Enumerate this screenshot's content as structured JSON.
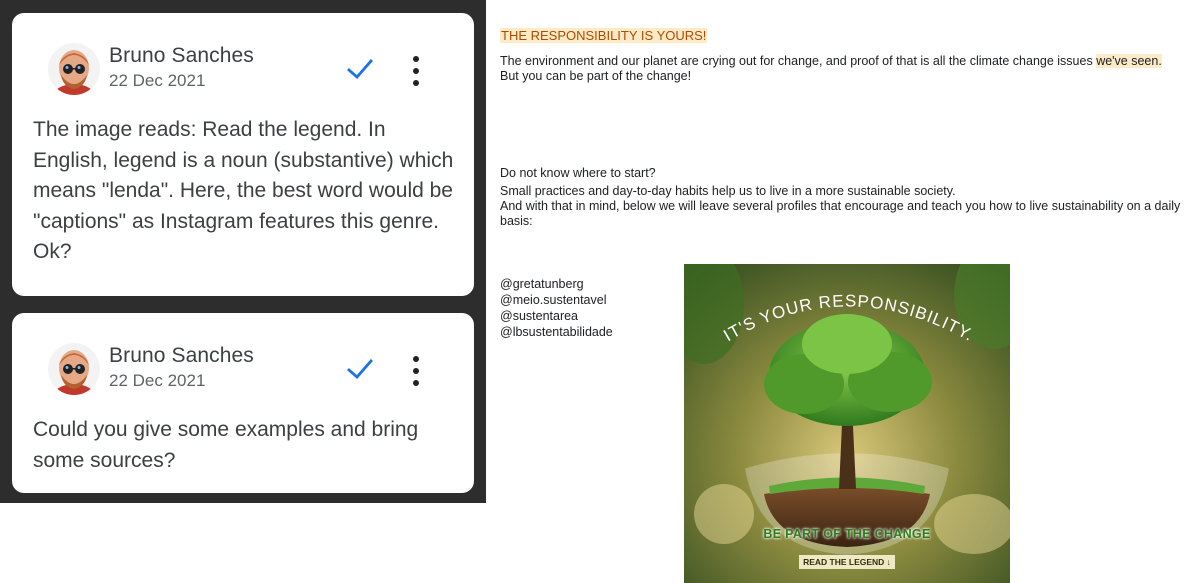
{
  "comments": [
    {
      "author": "Bruno Sanches",
      "date": "22 Dec 2021",
      "text": "The image reads: Read the legend. In English, legend is a noun (substantive) which means \"lenda\". Here, the best word would be \"captions\" as Instagram features this genre. Ok?"
    },
    {
      "author": "Bruno Sanches",
      "date": "22 Dec 2021",
      "text": "Could you give some examples and bring some sources?"
    }
  ],
  "document": {
    "title": "THE RESPONSIBILITY IS YOURS!",
    "paragraph1_a": "The environment and our planet are crying out for change, and proof of that is all the climate change issues ",
    "paragraph1_highlight": "we've seen.",
    "paragraph2": "But you can be part of the change!",
    "paragraph3": "Do not know where to start?",
    "paragraph4": "Small practices and day-to-day habits help us to live in a more sustainable society.",
    "paragraph5": "And with that in mind, below we will leave several profiles that encourage and teach you how to live sustainability on a daily basis:",
    "handles": [
      "@gretatunberg",
      "@meio.sustentavel",
      "@sustentarea",
      "@lbsustentabilidade"
    ]
  },
  "poster": {
    "headline": "IT'S YOUR RESPONSIBILITY.",
    "cta": "BE PART OF THE CHANGE",
    "legend": "READ THE LEGEND"
  },
  "colors": {
    "panel_bg": "#2d2d2d",
    "resolve_check": "#1a73e8",
    "highlight": "#fdebc8",
    "title_text": "#b04a00"
  },
  "icons": {
    "resolve": "check-icon",
    "more": "more-vertical-icon",
    "legend_arrow": "arrow-down-icon"
  }
}
